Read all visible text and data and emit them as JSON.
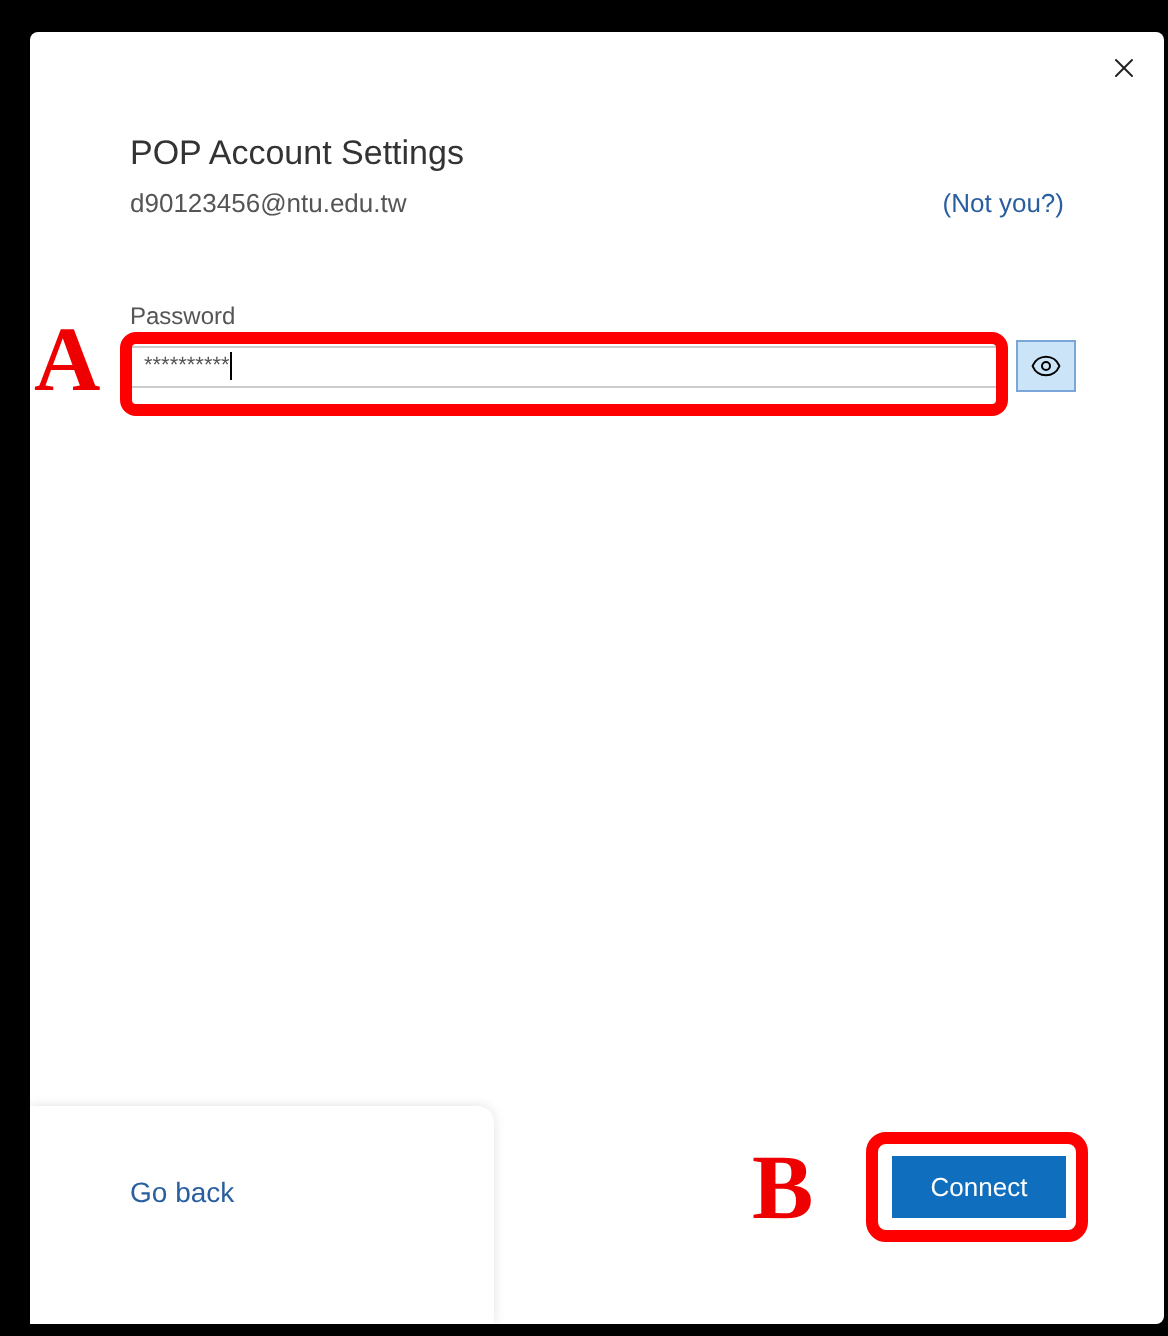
{
  "dialog": {
    "title": "POP Account Settings",
    "account": "d90123456@ntu.edu.tw",
    "not_you_link": "(Not you?)",
    "password": {
      "label": "Password",
      "value": "**********",
      "revealed": false
    },
    "go_back_link": "Go back",
    "connect_button": "Connect"
  },
  "annotations": [
    {
      "letter": "A"
    },
    {
      "letter": "B"
    }
  ]
}
